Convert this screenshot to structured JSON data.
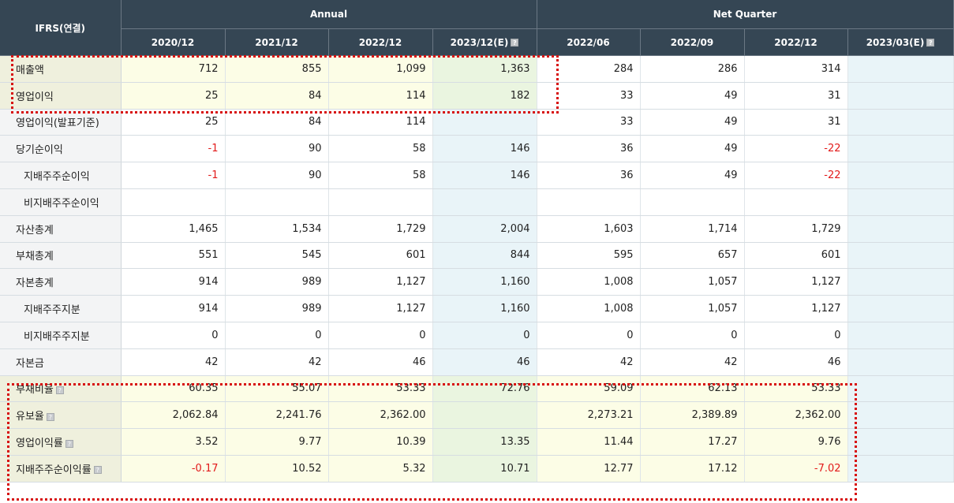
{
  "header": {
    "corner": "IFRS(연결)",
    "annual_label": "Annual",
    "quarter_label": "Net Quarter",
    "annual_periods": [
      "2020/12",
      "2021/12",
      "2022/12",
      "2023/12(E)"
    ],
    "quarter_periods": [
      "2022/06",
      "2022/09",
      "2022/12",
      "2023/03(E)"
    ]
  },
  "rows": [
    {
      "label": "매출액",
      "values": [
        "712",
        "855",
        "1,099",
        "1,363",
        "284",
        "286",
        "314",
        ""
      ]
    },
    {
      "label": "영업이익",
      "values": [
        "25",
        "84",
        "114",
        "182",
        "33",
        "49",
        "31",
        ""
      ]
    },
    {
      "label": "영업이익(발표기준)",
      "values": [
        "25",
        "84",
        "114",
        "",
        "33",
        "49",
        "31",
        ""
      ]
    },
    {
      "label": "당기순이익",
      "values": [
        "-1",
        "90",
        "58",
        "146",
        "36",
        "49",
        "-22",
        ""
      ]
    },
    {
      "label": "지배주주순이익",
      "values": [
        "-1",
        "90",
        "58",
        "146",
        "36",
        "49",
        "-22",
        ""
      ]
    },
    {
      "label": "비지배주주순이익",
      "values": [
        "",
        "",
        "",
        "",
        "",
        "",
        "",
        ""
      ]
    },
    {
      "label": "자산총계",
      "values": [
        "1,465",
        "1,534",
        "1,729",
        "2,004",
        "1,603",
        "1,714",
        "1,729",
        ""
      ]
    },
    {
      "label": "부채총계",
      "values": [
        "551",
        "545",
        "601",
        "844",
        "595",
        "657",
        "601",
        ""
      ]
    },
    {
      "label": "자본총계",
      "values": [
        "914",
        "989",
        "1,127",
        "1,160",
        "1,008",
        "1,057",
        "1,127",
        ""
      ]
    },
    {
      "label": "지배주주지분",
      "values": [
        "914",
        "989",
        "1,127",
        "1,160",
        "1,008",
        "1,057",
        "1,127",
        ""
      ]
    },
    {
      "label": "비지배주주지분",
      "values": [
        "0",
        "0",
        "0",
        "0",
        "0",
        "0",
        "0",
        ""
      ]
    },
    {
      "label": "자본금",
      "values": [
        "42",
        "42",
        "46",
        "46",
        "42",
        "42",
        "46",
        ""
      ]
    },
    {
      "label": "부채비율",
      "values": [
        "60.35",
        "55.07",
        "53.33",
        "72.76",
        "59.09",
        "62.13",
        "53.33",
        ""
      ]
    },
    {
      "label": "유보율",
      "values": [
        "2,062.84",
        "2,241.76",
        "2,362.00",
        "",
        "2,273.21",
        "2,389.89",
        "2,362.00",
        ""
      ]
    },
    {
      "label": "영업이익률",
      "values": [
        "3.52",
        "9.77",
        "10.39",
        "13.35",
        "11.44",
        "17.27",
        "9.76",
        ""
      ]
    },
    {
      "label": "지배주주순이익률",
      "values": [
        "-0.17",
        "10.52",
        "5.32",
        "10.71",
        "12.77",
        "17.12",
        "-7.02",
        ""
      ]
    }
  ],
  "help_icon": "?",
  "colors": {
    "header_bg": "#354654",
    "highlight_border": "#d70f0f",
    "negative": "#e21a1a",
    "estimate_bg": "#e9f4f8"
  }
}
